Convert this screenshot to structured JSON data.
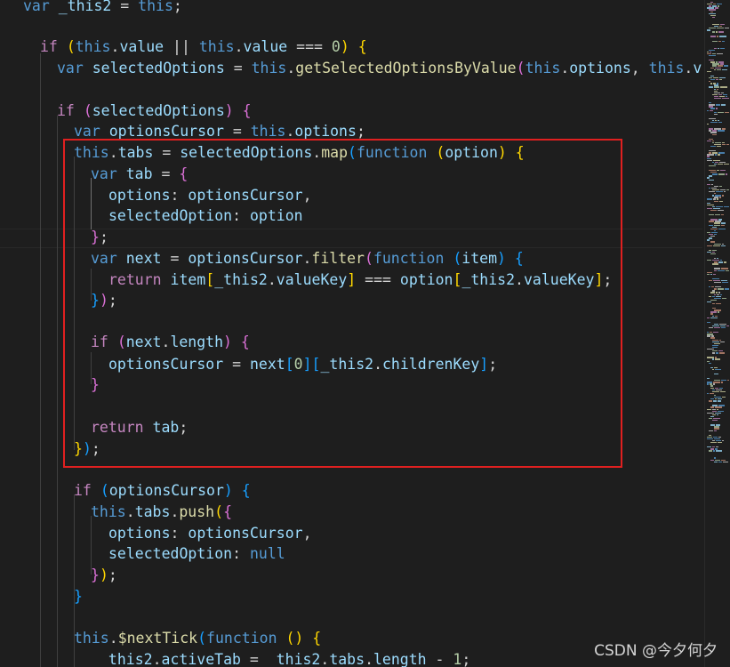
{
  "editor": {
    "lines": [
      [
        "  var _this2 = this;"
      ],
      [
        ""
      ],
      [
        "  if (this.value || this.value === 0) {"
      ],
      [
        "    var selectedOptions = this.getSelectedOptionsByValue(this.options, this.val"
      ],
      [
        ""
      ],
      [
        "    if (selectedOptions) {"
      ],
      [
        "      var optionsCursor = this.options;"
      ],
      [
        "      this.tabs = selectedOptions.map(function (option) {"
      ],
      [
        "        var tab = {"
      ],
      [
        "          options: optionsCursor,"
      ],
      [
        "          selectedOption: option"
      ],
      [
        "        };"
      ],
      [
        "        var next = optionsCursor.filter(function (item) {"
      ],
      [
        "          return item[_this2.valueKey] === option[_this2.valueKey];"
      ],
      [
        "        });"
      ],
      [
        ""
      ],
      [
        "        if (next.length) {"
      ],
      [
        "          optionsCursor = next[0][_this2.childrenKey];"
      ],
      [
        "        }"
      ],
      [
        ""
      ],
      [
        "        return tab;"
      ],
      [
        "      });"
      ],
      [
        ""
      ],
      [
        "      if (optionsCursor) {"
      ],
      [
        "        this.tabs.push({"
      ],
      [
        "          options: optionsCursor,"
      ],
      [
        "          selectedOption: null"
      ],
      [
        "        });"
      ],
      [
        "      }"
      ],
      [
        ""
      ],
      [
        "      this.$nextTick(function () {"
      ],
      [
        "        _this2.activeTab = _this2.tabs.length - 1;"
      ]
    ]
  },
  "watermark": "CSDN @今夕何夕",
  "colors": {
    "background": "#1e1e1e",
    "highlight_border": "#e02020"
  }
}
